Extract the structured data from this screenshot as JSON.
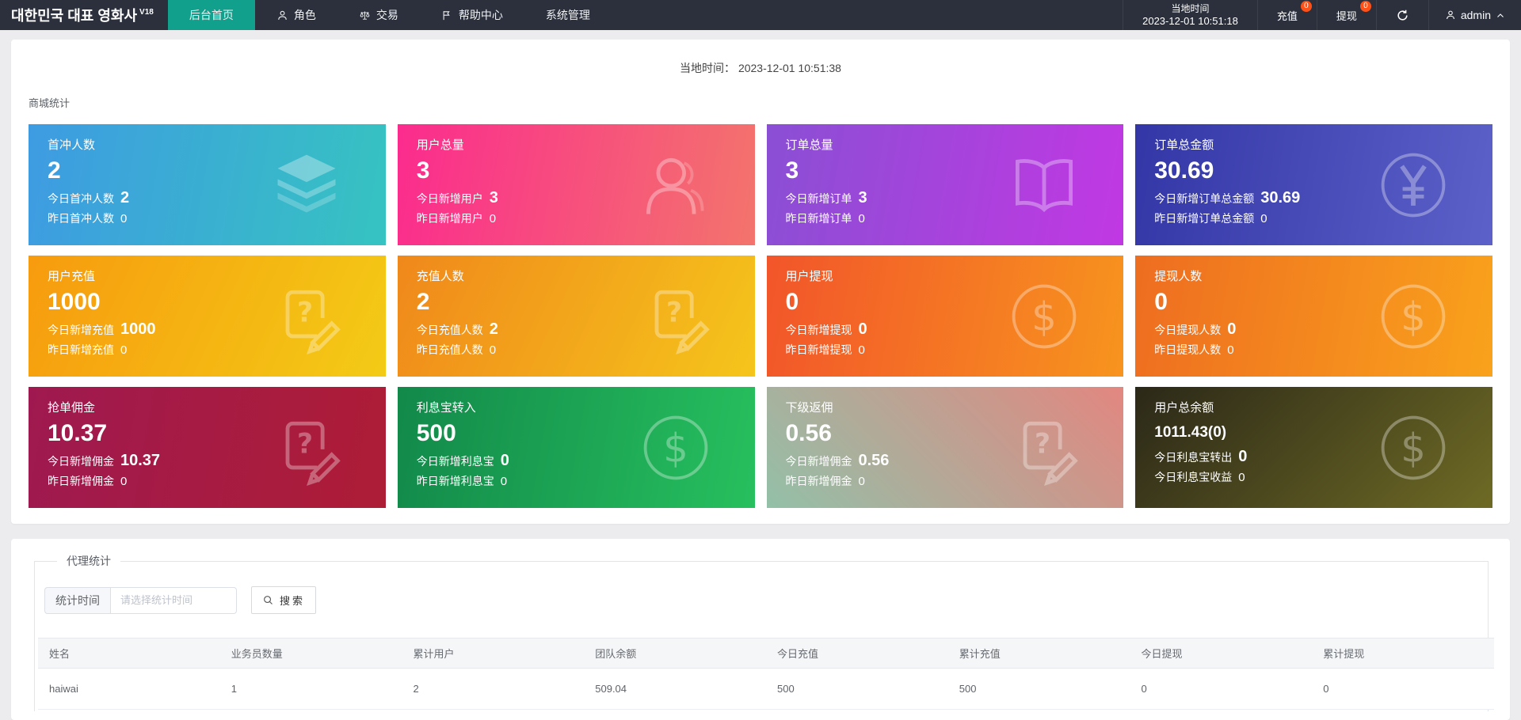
{
  "navbar": {
    "logo": "대한민국 대표 영화사",
    "logo_sup": "V18",
    "menu": [
      {
        "label": "后台首页",
        "icon": null,
        "active": true
      },
      {
        "label": "角色",
        "icon": "user",
        "active": false
      },
      {
        "label": "交易",
        "icon": "scales",
        "active": false
      },
      {
        "label": "帮助中心",
        "icon": "flag",
        "active": false
      },
      {
        "label": "系统管理",
        "icon": null,
        "active": false
      }
    ],
    "local_time_label": "当地时间",
    "local_time_value": "2023-12-01 10:51:18",
    "recharge_label": "充值",
    "recharge_badge": "0",
    "withdraw_label": "提现",
    "withdraw_badge": "0",
    "user_name": "admin",
    "active_color": "#10a08c",
    "badge_color": "#ff5117"
  },
  "content": {
    "time_line": {
      "label": "当地时间：",
      "value": "2023-12-01 10:51:38"
    },
    "stats_title": "商城统计",
    "cards": [
      {
        "title": "首冲人数",
        "value": "2",
        "today_label": "今日首冲人数",
        "today_value": "2",
        "yesterday_label": "昨日首冲人数",
        "yesterday_value": "0",
        "icon": "layers-icon",
        "colors": [
          "#3e9be2",
          "#36c3c1"
        ],
        "angle": 100,
        "small": false
      },
      {
        "title": "用户总量",
        "value": "3",
        "today_label": "今日新增用户",
        "today_value": "3",
        "yesterday_label": "昨日新增用户",
        "yesterday_value": "0",
        "icon": "person-icon",
        "colors": [
          "#fb2b8e",
          "#f3746c"
        ],
        "angle": 100,
        "small": false
      },
      {
        "title": "订单总量",
        "value": "3",
        "today_label": "今日新增订单",
        "today_value": "3",
        "yesterday_label": "昨日新增订单",
        "yesterday_value": "0",
        "icon": "book-icon",
        "colors": [
          "#8a4fd4",
          "#c138e3"
        ],
        "angle": 100,
        "small": false
      },
      {
        "title": "订单总金额",
        "value": "30.69",
        "today_label": "今日新增订单总金额",
        "today_value": "30.69",
        "yesterday_label": "昨日新增订单总金额",
        "yesterday_value": "0",
        "icon": "yen-circle-icon",
        "colors": [
          "#3336a6",
          "#5c61c9"
        ],
        "angle": 100,
        "small": false
      },
      {
        "title": "用户充值",
        "value": "1000",
        "today_label": "今日新增充值",
        "today_value": "1000",
        "yesterday_label": "昨日新增充值",
        "yesterday_value": "0",
        "icon": "doc-question-icon",
        "colors": [
          "#f79b0e",
          "#f3cb16"
        ],
        "angle": 115,
        "small": false
      },
      {
        "title": "充值人数",
        "value": "2",
        "today_label": "今日充值人数",
        "today_value": "2",
        "yesterday_label": "昨日充值人数",
        "yesterday_value": "0",
        "icon": "doc-question-icon",
        "colors": [
          "#f0881b",
          "#f5c51b"
        ],
        "angle": 115,
        "small": false
      },
      {
        "title": "用户提现",
        "value": "0",
        "today_label": "今日新增提现",
        "today_value": "0",
        "yesterday_label": "昨日新增提现",
        "yesterday_value": "0",
        "icon": "dollar-circle-icon",
        "colors": [
          "#f2552a",
          "#f7941e"
        ],
        "angle": 100,
        "small": false
      },
      {
        "title": "提现人数",
        "value": "0",
        "today_label": "今日提现人数",
        "today_value": "0",
        "yesterday_label": "昨日提现人数",
        "yesterday_value": "0",
        "icon": "dollar-circle-icon",
        "colors": [
          "#ee6d20",
          "#f9a21c"
        ],
        "angle": 100,
        "small": false
      },
      {
        "title": "抢单佣金",
        "value": "10.37",
        "today_label": "今日新增佣金",
        "today_value": "10.37",
        "yesterday_label": "昨日新增佣金",
        "yesterday_value": "0",
        "icon": "doc-question-icon",
        "colors": [
          "#9f1950",
          "#ae1d36"
        ],
        "angle": 100,
        "small": false
      },
      {
        "title": "利息宝转入",
        "value": "500",
        "today_label": "今日新增利息宝",
        "today_value": "0",
        "yesterday_label": "昨日新增利息宝",
        "yesterday_value": "0",
        "icon": "dollar-circle-icon",
        "colors": [
          "#12894a",
          "#27c05e"
        ],
        "angle": 100,
        "small": false
      },
      {
        "title": "下级返佣",
        "value": "0.56",
        "today_label": "今日新增佣金",
        "today_value": "0.56",
        "yesterday_label": "昨日新增佣金",
        "yesterday_value": "0",
        "icon": "doc-question-icon",
        "colors": [
          "#93c0a8",
          "#e28780"
        ],
        "angle": 45,
        "small": false
      },
      {
        "title": "用户总余额",
        "value": "1011.43(0)",
        "today_label": "今日利息宝转出",
        "today_value": "0",
        "yesterday_label": "今日利息宝收益",
        "yesterday_value": "0",
        "icon": "dollar-circle-icon",
        "colors": [
          "#2b2818",
          "#6e6a25"
        ],
        "angle": 135,
        "small": true
      }
    ],
    "agent": {
      "legend": "代理统计",
      "form": {
        "label": "统计时间",
        "placeholder": "请选择统计时间",
        "search_label": "搜索"
      },
      "table": {
        "headers": [
          "姓名",
          "业务员数量",
          "累计用户",
          "团队余额",
          "今日充值",
          "累计充值",
          "今日提现",
          "累计提现"
        ],
        "rows": [
          [
            "haiwai",
            "1",
            "2",
            "509.04",
            "500",
            "500",
            "0",
            "0"
          ]
        ]
      }
    }
  }
}
